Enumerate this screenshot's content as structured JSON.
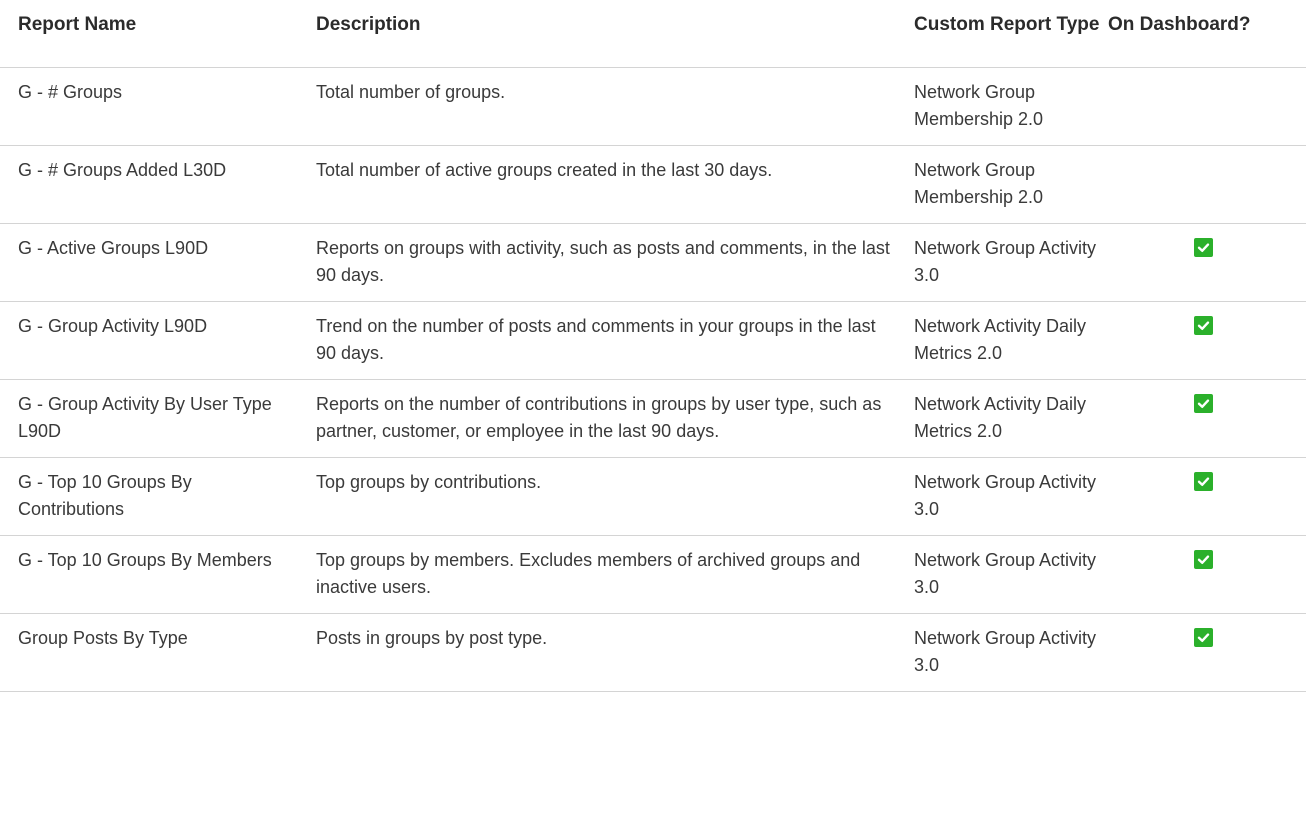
{
  "table": {
    "headers": {
      "report_name": "Report Name",
      "description": "Description",
      "custom_report_type": "Custom Report Type",
      "on_dashboard": "On Dashboard?"
    },
    "rows": [
      {
        "name": "G - # Groups",
        "description": "Total number of groups.",
        "report_type": "Network Group Membership 2.0",
        "on_dashboard": false
      },
      {
        "name": "G - # Groups Added L30D",
        "description": "Total number of active groups created in the last 30 days.",
        "report_type": "Network Group Membership 2.0",
        "on_dashboard": false
      },
      {
        "name": "G - Active Groups L90D",
        "description": "Reports on groups with activity, such as posts and comments, in the last 90 days.",
        "report_type": "Network Group Activity 3.0",
        "on_dashboard": true
      },
      {
        "name": "G - Group Activity L90D",
        "description": "Trend on the number of posts and comments in your groups in the last 90 days.",
        "report_type": "Network Activity Daily Metrics 2.0",
        "on_dashboard": true
      },
      {
        "name": "G - Group Activity By User Type L90D",
        "description": "Reports on the number of contributions in groups by user type, such as partner, customer, or employee in the last 90 days.",
        "report_type": "Network Activity Daily Metrics 2.0",
        "on_dashboard": true
      },
      {
        "name": "G - Top 10 Groups By Contributions",
        "description": "Top groups by contributions.",
        "report_type": "Network Group Activity 3.0",
        "on_dashboard": true
      },
      {
        "name": "G - Top 10 Groups By Members",
        "description": "Top groups by members. Excludes members of archived groups and inactive users.",
        "report_type": "Network Group Activity 3.0",
        "on_dashboard": true
      },
      {
        "name": "Group Posts By Type",
        "description": "Posts in groups by post type.",
        "report_type": "Network Group Activity 3.0",
        "on_dashboard": true
      }
    ]
  },
  "icons": {
    "checked": "checkbox-checked-icon"
  },
  "colors": {
    "check_green": "#2bb02b",
    "border": "#d4d4d4",
    "text": "#3a3a3a"
  }
}
